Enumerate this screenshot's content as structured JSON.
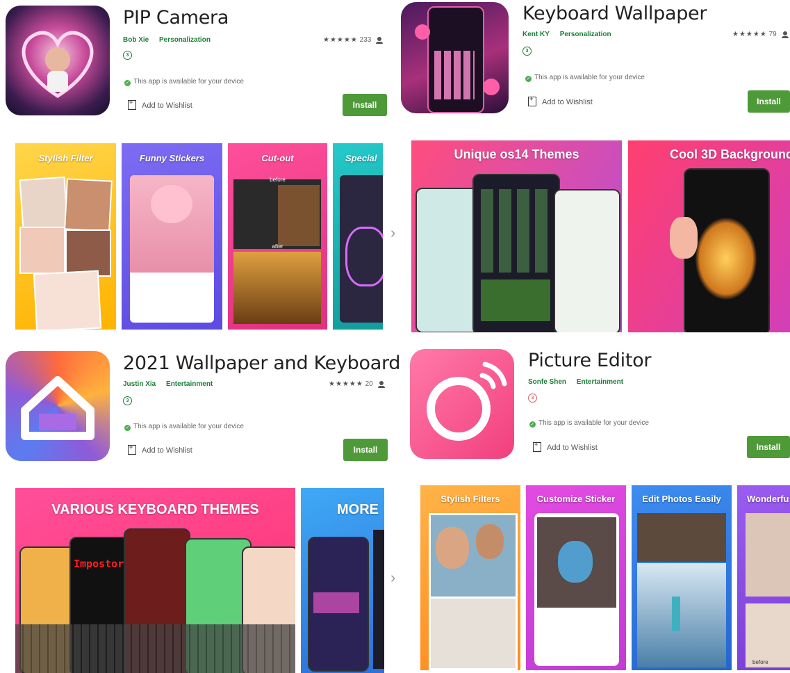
{
  "apps": [
    {
      "title": "PIP Camera",
      "developer": "Bob Xie",
      "category": "Personalization",
      "rating_count": "233",
      "stars": "★★★★★",
      "availability": "This app is available for your device",
      "wishlist": "Add to Wishlist",
      "install": "Install",
      "badge": "3",
      "screenshots": [
        "Stylish Filter",
        "Funny Stickers",
        "Cut-out",
        "Special"
      ],
      "sub_labels": [
        "before",
        "after"
      ]
    },
    {
      "title": "Keyboard Wallpaper",
      "developer": "Kent KY",
      "category": "Personalization",
      "rating_count": "79",
      "stars": "★★★★★",
      "availability": "This app is available for your device",
      "wishlist": "Add to Wishlist",
      "install": "Install",
      "badge": "3",
      "screenshots": [
        "Unique os14 Themes",
        "Cool 3D Background"
      ]
    },
    {
      "title": "2021 Wallpaper and Keyboard",
      "developer": "Justin Xia",
      "category": "Entertainment",
      "rating_count": "20",
      "stars": "★★★★★",
      "availability": "This app is available for your device",
      "wishlist": "Add to Wishlist",
      "install": "Install",
      "badge": "3",
      "screenshots": [
        "VARIOUS KEYBOARD THEMES",
        "MORE"
      ]
    },
    {
      "title": "Picture Editor",
      "developer": "Sonfe Shen",
      "category": "Entertainment",
      "availability": "This app is available for your device",
      "wishlist": "Add to Wishlist",
      "install": "Install",
      "badge": "3",
      "screenshots": [
        "Stylish Filters",
        "Customize Sticker",
        "Edit Photos Easily",
        "Wonderfu"
      ],
      "sub_labels": [
        "before"
      ]
    }
  ],
  "nav": {
    "next": "›"
  },
  "colors": {
    "install_green": "#4e9a39",
    "meta_green": "#1a7f37"
  }
}
